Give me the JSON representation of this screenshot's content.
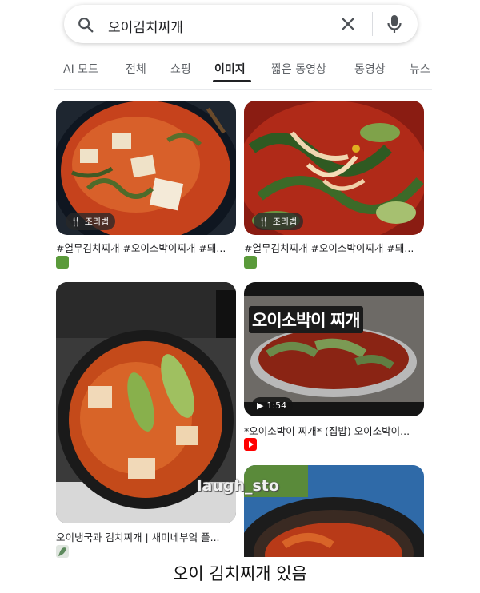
{
  "search": {
    "query": "오이김치찌개"
  },
  "tabs": [
    {
      "label": "AI 모드"
    },
    {
      "label": "전체"
    },
    {
      "label": "쇼핑"
    },
    {
      "label": "이미지"
    },
    {
      "label": "짧은 동영상"
    },
    {
      "label": "동영상"
    },
    {
      "label": "뉴스"
    }
  ],
  "active_tab": "이미지",
  "results": [
    {
      "badge": "조리법",
      "caption": "#열무김치찌개 #오이소박이찌개 #돼..."
    },
    {
      "badge": "조리법",
      "caption": "#열무김치찌개 #오이소박이찌개 #돼..."
    },
    {
      "caption": "오이냉국과 김치찌개 | 새미네부엌 플..."
    },
    {
      "overlay_title": "오이소박이 찌개",
      "duration": "1:54",
      "caption": "*오이소박이 찌개* (집밥) 오이소박이..."
    },
    {}
  ],
  "watermark": "laugh_sto",
  "bottom_caption": "오이 김치찌개 있음",
  "colors": {
    "accent": "#202124",
    "youtube_red": "#ff0000"
  }
}
